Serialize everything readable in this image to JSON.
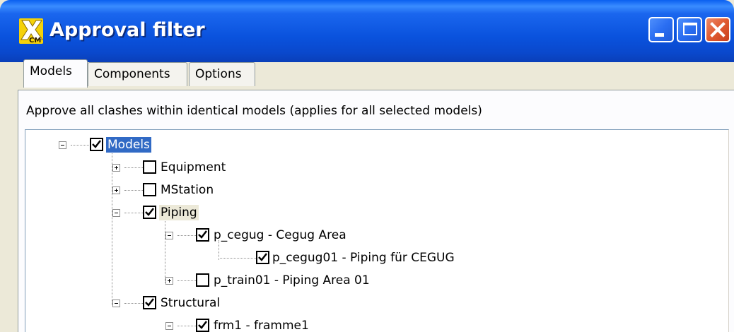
{
  "window": {
    "title": "Approval filter",
    "controls": [
      "minimize-icon",
      "maximize-icon",
      "close-icon"
    ]
  },
  "tabs": [
    {
      "label": "Models",
      "active": true
    },
    {
      "label": "Components",
      "active": false
    },
    {
      "label": "Options",
      "active": false
    }
  ],
  "panel": {
    "description": "Approve all clashes within identical models (applies for all selected models)"
  },
  "tree": [
    {
      "label": "Models",
      "checked": true,
      "expanded": true,
      "selected": true
    },
    {
      "label": "Equipment",
      "checked": false,
      "expanded": false
    },
    {
      "label": "MStation",
      "checked": false,
      "expanded": false
    },
    {
      "label": "Piping",
      "checked": true,
      "expanded": true,
      "hover": true
    },
    {
      "label": "p_cegug - Cegug Area",
      "checked": true,
      "expanded": true
    },
    {
      "label": "p_cegug01 - Piping für CEGUG",
      "checked": true
    },
    {
      "label": "p_train01 - Piping Area 01",
      "checked": false,
      "expanded": false
    },
    {
      "label": "Structural",
      "checked": true,
      "expanded": true
    },
    {
      "label": "frm1 - framme1",
      "checked": true,
      "expanded": true
    }
  ],
  "colors": {
    "titlebar": "#0a52dd",
    "selection": "#316ac5",
    "close_button": "#e05a30",
    "dialog_face": "#ece9d8"
  }
}
